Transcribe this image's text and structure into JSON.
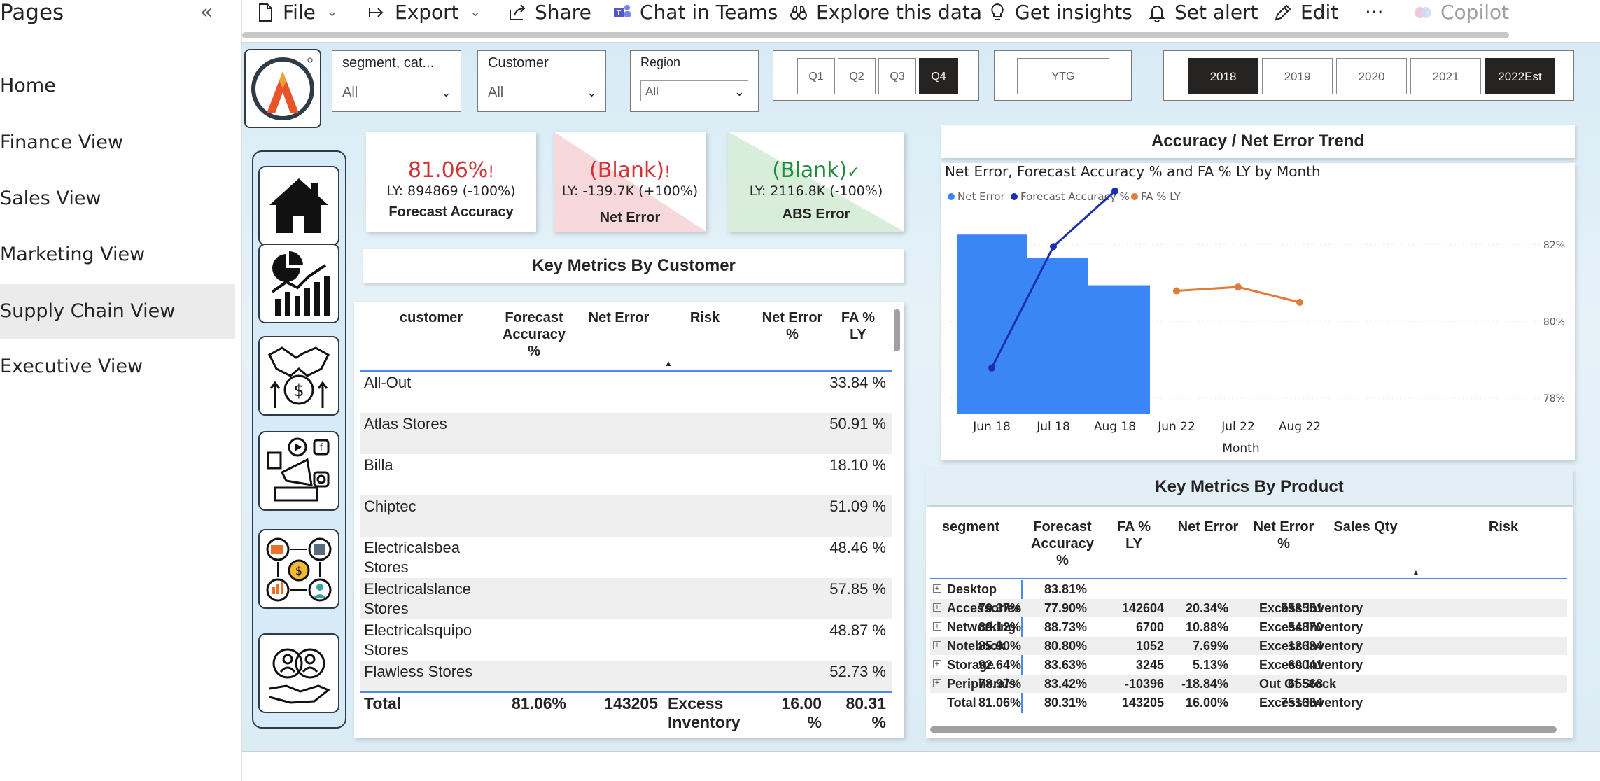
{
  "pages_panel": {
    "title": "Pages",
    "collapse_glyph": "«",
    "items": [
      {
        "label": "Home",
        "active": false
      },
      {
        "label": "Finance View",
        "active": false
      },
      {
        "label": "Sales View",
        "active": false
      },
      {
        "label": "Marketing View",
        "active": false
      },
      {
        "label": "Supply Chain View",
        "active": true
      },
      {
        "label": "Executive View",
        "active": false
      }
    ]
  },
  "toolbar": {
    "file": "File",
    "export": "Export",
    "share": "Share",
    "chat_in_teams": "Chat in Teams",
    "explore": "Explore this data",
    "insights": "Get insights",
    "alert": "Set alert",
    "edit": "Edit",
    "more": "···",
    "copilot": "Copilot"
  },
  "slicers": {
    "segment": {
      "label": "segment, cat...",
      "value": "All"
    },
    "customer": {
      "label": "Customer",
      "value": "All"
    },
    "region": {
      "label": "Region",
      "value": "All"
    }
  },
  "quarters": {
    "items": [
      "Q1",
      "Q2",
      "Q3",
      "Q4"
    ],
    "selected": "Q4"
  },
  "ytg": {
    "label": "YTG"
  },
  "years": {
    "items": [
      "2018",
      "2019",
      "2020",
      "2021",
      "2022Est"
    ],
    "selected": [
      "2018",
      "2022Est"
    ]
  },
  "kpis": {
    "forecast_accuracy": {
      "value": "81.06%",
      "flag": "!",
      "ly": "LY: 894869 (-100%)",
      "title": "Forecast Accuracy",
      "color": "#d13438"
    },
    "net_error": {
      "value": "(Blank)",
      "flag": "!",
      "ly": "LY: -139.7K (+100%)",
      "title": "Net Error",
      "color": "#d13438"
    },
    "abs_error": {
      "value": "(Blank)",
      "flag": "✓",
      "ly": "LY: 2116.8K (-100%)",
      "title": "ABS Error",
      "color": "#1e8e3e"
    }
  },
  "customer_section": {
    "title": "Key Metrics By Customer"
  },
  "customer_table": {
    "headers": {
      "customer": "customer",
      "fa": "Forecast Accuracy %",
      "net_error": "Net Error",
      "risk": "Risk",
      "net_error_pct": "Net Error %",
      "fa_ly": "FA % LY"
    },
    "rows": [
      {
        "name": "All-Out",
        "fa_ly": "33.84 %"
      },
      {
        "name": "Atlas Stores",
        "fa_ly": "50.91 %"
      },
      {
        "name": "Billa",
        "fa_ly": "18.10 %"
      },
      {
        "name": "Chiptec",
        "fa_ly": "51.09 %"
      },
      {
        "name": "Electricalsbea Stores",
        "fa_ly": "48.46 %"
      },
      {
        "name": "Electricalslance Stores",
        "fa_ly": "57.85 %"
      },
      {
        "name": "Electricalsquipo Stores",
        "fa_ly": "48.87 %"
      },
      {
        "name": "Flawless Stores",
        "fa_ly": "52.73 %"
      }
    ],
    "total": {
      "label": "Total",
      "fa": "81.06%",
      "net_error": "143205",
      "risk": "Excess Inventory",
      "net_error_pct": "16.00 %",
      "fa_ly": "80.31 %"
    }
  },
  "chart_section": {
    "title": "Accuracy / Net Error Trend"
  },
  "chart_data": {
    "type": "bar",
    "title": "Net Error, Forecast Accuracy % and FA % LY by Month",
    "xlabel": "Month",
    "categories": [
      "Jun 18",
      "Jul 18",
      "Aug 18",
      "Jun 22",
      "Jul 22",
      "Aug 22"
    ],
    "series": [
      {
        "name": "Net Error",
        "kind": "bar",
        "color": "#3a86f7",
        "values": [
          0.92,
          0.8,
          0.66,
          null,
          null,
          null
        ]
      },
      {
        "name": "Forecast Accuracy %",
        "kind": "line",
        "color": "#1a2eb0",
        "values": [
          0.12,
          0.71,
          0.98,
          null,
          null,
          null
        ]
      },
      {
        "name": "FA % LY",
        "kind": "line",
        "color": "#e07b39",
        "values": [
          null,
          null,
          null,
          80.8,
          80.9,
          80.5
        ]
      }
    ],
    "right_axis": {
      "ticks": [
        "82%",
        "80%",
        "78%"
      ],
      "ylim": [
        77.6,
        83.4
      ]
    },
    "legend": "top-left"
  },
  "product_section": {
    "title": "Key Metrics By Product"
  },
  "product_table": {
    "headers": {
      "segment": "segment",
      "fa": "Forecast Accuracy %",
      "fa_ly": "FA % LY",
      "net_error": "Net Error",
      "net_error_pct": "Net Error %",
      "sales_qty": "Sales Qty",
      "risk": "Risk"
    },
    "rows": [
      {
        "segment": "Desktop",
        "fa": "",
        "fa_ly": "83.81%",
        "net_error": "",
        "net_error_pct": "",
        "sales_qty": "",
        "risk": ""
      },
      {
        "segment": "Accessories",
        "fa": "79.37%",
        "fa_ly": "77.90%",
        "net_error": "142604",
        "net_error_pct": "20.34%",
        "sales_qty": "558551",
        "risk": "Excess Inventory"
      },
      {
        "segment": "Networking",
        "fa": "89.12%",
        "fa_ly": "88.73%",
        "net_error": "6700",
        "net_error_pct": "10.88%",
        "sales_qty": "54870",
        "risk": "Excess Inventory"
      },
      {
        "segment": "Notebook",
        "fa": "85.90%",
        "fa_ly": "80.80%",
        "net_error": "1052",
        "net_error_pct": "7.69%",
        "sales_qty": "12634",
        "risk": "Excess Inventory"
      },
      {
        "segment": "Storage",
        "fa": "92.64%",
        "fa_ly": "83.63%",
        "net_error": "3245",
        "net_error_pct": "5.13%",
        "sales_qty": "60041",
        "risk": "Excess Inventory"
      },
      {
        "segment": "Peripherals",
        "fa": "78.97%",
        "fa_ly": "83.42%",
        "net_error": "-10396",
        "net_error_pct": "-18.84%",
        "sales_qty": "65568",
        "risk": "Out Of Stock"
      }
    ],
    "total": {
      "segment": "Total",
      "fa": "81.06%",
      "fa_ly": "80.31%",
      "net_error": "143205",
      "net_error_pct": "16.00%",
      "sales_qty": "751664",
      "risk": "Excess Inventory"
    }
  },
  "icons": {
    "nav": [
      "home-icon",
      "finance-chart-icon",
      "sales-handshake-icon",
      "marketing-megaphone-icon",
      "supply-chain-icon",
      "executive-people-icon"
    ]
  }
}
